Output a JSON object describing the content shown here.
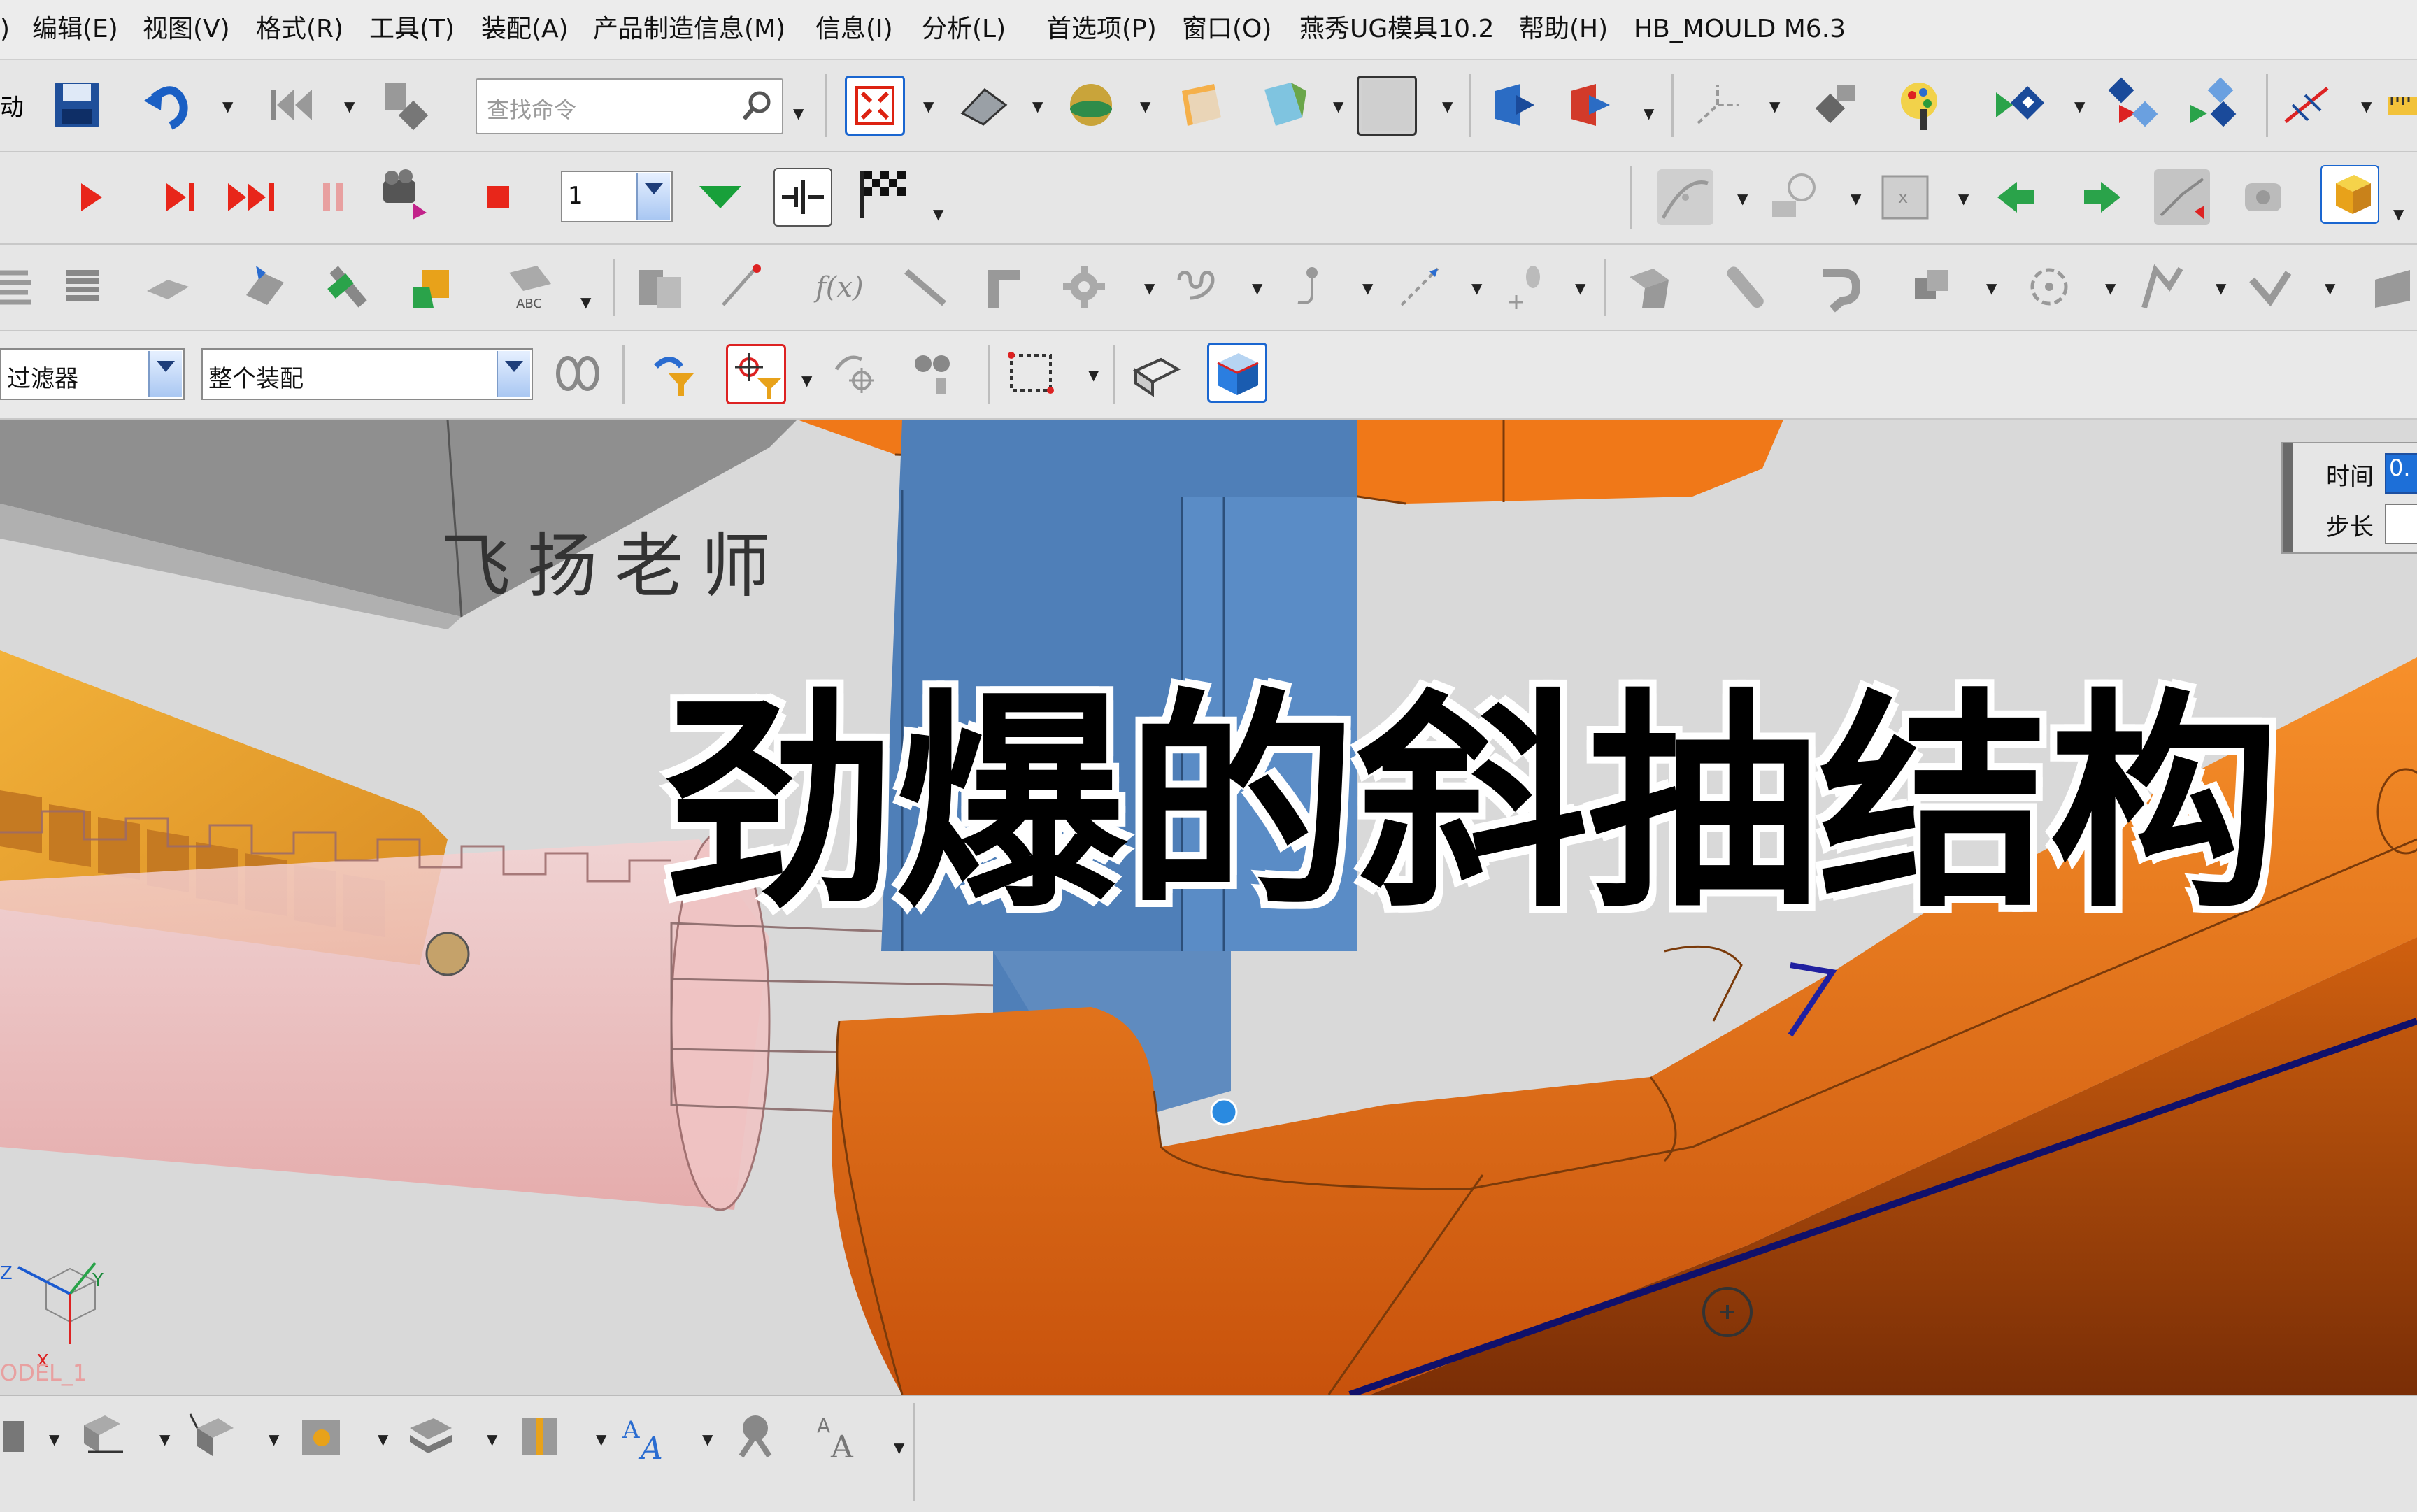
{
  "menubar": {
    "items": [
      {
        "label": ")"
      },
      {
        "label": "编辑(E)"
      },
      {
        "label": "视图(V)"
      },
      {
        "label": "格式(R)"
      },
      {
        "label": "工具(T)"
      },
      {
        "label": "装配(A)"
      },
      {
        "label": "产品制造信息(M)"
      },
      {
        "label": "信息(I)"
      },
      {
        "label": "分析(L)"
      },
      {
        "label": "首选项(P)"
      },
      {
        "label": "窗口(O)"
      },
      {
        "label": "燕秀UG模具10.2"
      },
      {
        "label": "帮助(H)"
      },
      {
        "label": "HB_MOULD M6.3"
      }
    ]
  },
  "toolbar1": {
    "left_cut_label": "动",
    "search_placeholder": "查找命令"
  },
  "toolbar2": {
    "frame_value": "1"
  },
  "selection_bar": {
    "type_filter_value": "过滤器",
    "scope_value": "整个装配"
  },
  "viewport": {
    "watermark": "飞扬老师",
    "caption": "劲爆的斜抽结构",
    "time_panel": {
      "time_label": "时间",
      "time_value": "0.",
      "step_label": "步长",
      "step_value": ""
    },
    "triad": {
      "z_label": "Z",
      "y_label": "Y",
      "x_label": "X",
      "model_label": "ODEL_1"
    }
  },
  "colors": {
    "orange_part": "#f07818",
    "blue_part": "#4f7fb8",
    "gray_block": "#8f8f8f",
    "pink_rod": "#e8b4b4",
    "yellow_rack": "#e8a23a"
  }
}
